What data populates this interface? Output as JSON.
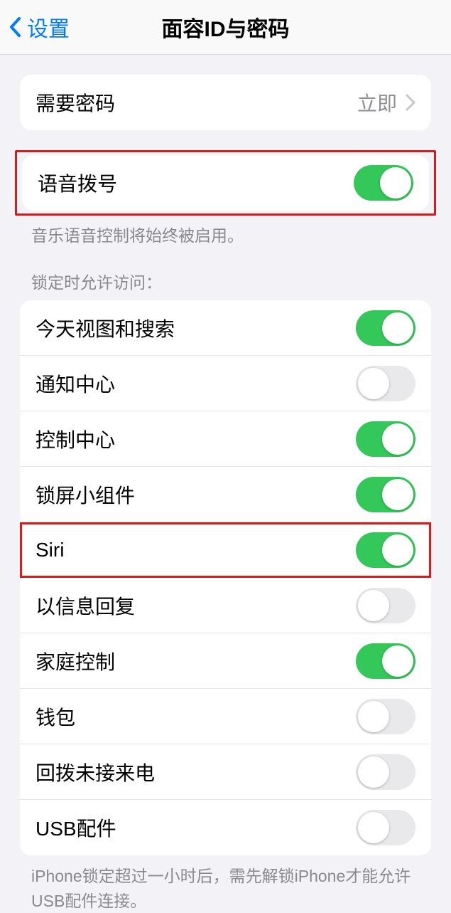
{
  "nav": {
    "back_label": "设置",
    "title": "面容ID与密码"
  },
  "passcode_group": {
    "require_passcode": {
      "label": "需要密码",
      "value": "立即"
    }
  },
  "voice_dial": {
    "label": "语音拨号",
    "on": true,
    "footer": "音乐语音控制将始终被启用。"
  },
  "lock_access": {
    "header": "锁定时允许访问：",
    "items": [
      {
        "label": "今天视图和搜索",
        "on": true
      },
      {
        "label": "通知中心",
        "on": false
      },
      {
        "label": "控制中心",
        "on": true
      },
      {
        "label": "锁屏小组件",
        "on": true
      },
      {
        "label": "Siri",
        "on": true,
        "highlight": true
      },
      {
        "label": "以信息回复",
        "on": false
      },
      {
        "label": "家庭控制",
        "on": true
      },
      {
        "label": "钱包",
        "on": false
      },
      {
        "label": "回拨未接来电",
        "on": false
      },
      {
        "label": "USB配件",
        "on": false
      }
    ],
    "footer": "iPhone锁定超过一小时后，需先解锁iPhone才能允许USB配件连接。"
  }
}
